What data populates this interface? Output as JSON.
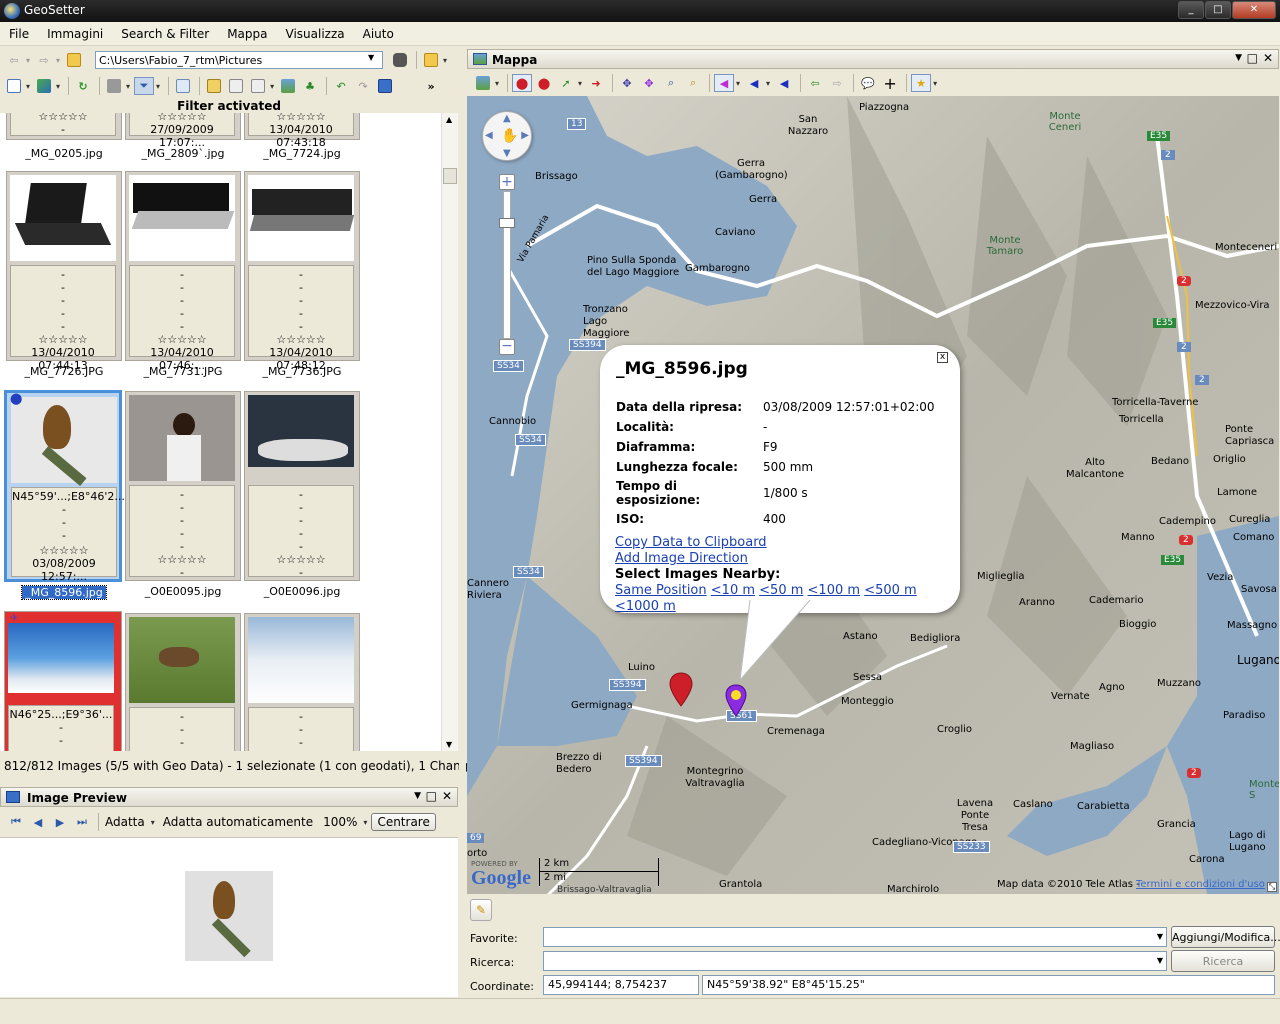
{
  "window": {
    "title": "GeoSetter",
    "buttons": [
      "_",
      "□",
      "✕"
    ]
  },
  "menu": [
    "File",
    "Immagini",
    "Search & Filter",
    "Mappa",
    "Visualizza",
    "Aiuto"
  ],
  "path": {
    "value": "C:\\Users\\Fabio_7_rtm\\Pictures"
  },
  "filter_label": "Filter activated",
  "thumbnails": {
    "row0": [
      {
        "date": "-",
        "name": "_MG_0205.jpg"
      },
      {
        "date": "27/09/2009 17:07:...",
        "name": "_MG_2809`.jpg"
      },
      {
        "date": "13/04/2010 07:43:18",
        "name": "_MG_7724.jpg"
      }
    ],
    "row1": [
      {
        "date": "13/04/2010 07:44:13",
        "name": "_MG_7726.JPG"
      },
      {
        "date": "13/04/2010 07:46:...",
        "name": "_MG_7731.JPG"
      },
      {
        "date": "13/04/2010 07:48:12",
        "name": "_MG_7736.JPG"
      }
    ],
    "row2": [
      {
        "coords": "N45°59'...;E8°46'2...",
        "date": "03/08/2009 12:57:...",
        "name": "_MG_8596.jpg"
      },
      {
        "coords": "-",
        "date": "-",
        "name": "_O0E0095.jpg"
      },
      {
        "coords": "-",
        "date": "-",
        "name": "_O0E0096.jpg"
      }
    ],
    "row3": [
      {
        "coords": "N46°25...;E9°36'..."
      },
      {
        "coords": "-"
      },
      {
        "coords": "-"
      }
    ],
    "dash": "-",
    "stars": "☆☆☆☆☆"
  },
  "status": "812/812 Images (5/5 with Geo Data) - 1 selezionate (1 con geodati), 1 Changed",
  "preview": {
    "title": "Image Preview",
    "fit": "Adatta",
    "autofit": "Adatta automaticamente",
    "zoom": "100%",
    "center": "Centrare"
  },
  "map_panel": {
    "title": "Mappa"
  },
  "popup": {
    "title": "_MG_8596.jpg",
    "close": "x",
    "rows": [
      {
        "k": "Data della ripresa:",
        "v": "03/08/2009 12:57:01+02:00"
      },
      {
        "k": "Località:",
        "v": "-"
      },
      {
        "k": "Diaframma:",
        "v": "F9"
      },
      {
        "k": "Lunghezza focale:",
        "v": "500 mm"
      },
      {
        "k": "Tempo di esposizione:",
        "v": "1/800 s"
      },
      {
        "k": "ISO:",
        "v": "400"
      }
    ],
    "copy": "Copy Data to Clipboard",
    "direction": "Add Image Direction",
    "nearby": "Select Images Nearby:",
    "same": "Same Position",
    "r10": "<10 m",
    "r50": "<50 m",
    "r100": "<100 m",
    "r500": "<500 m",
    "r1000": "<1000 m"
  },
  "map_labels": {
    "piazzogna": "Piazzogna",
    "san_nazzaro": "San Nazzaro",
    "monte_ceneri": "Monte Ceneri",
    "gerra_gamb": "Gerra (Gambarogno)",
    "gerra": "Gerra",
    "brissago": "Brissago",
    "caviano": "Caviano",
    "pino": "Pino Sulla Sponda del Lago Maggiore",
    "gambarogno": "Gambarogno",
    "monte_tamaro": "Monte Tamaro",
    "monteceneri": "Monteceneri",
    "tronzano": "Tronzano Lago Maggiore",
    "mezzovico": "Mezzovico-Vira",
    "cannobio": "Cannobio",
    "torricella_t": "Torricella-Taverne",
    "torricella": "Torricella",
    "ponte_capriasca": "Ponte Capriasca",
    "bedano": "Bedano",
    "origlio": "Origlio",
    "alto_malcantone": "Alto Malcantone",
    "lamone": "Lamone",
    "cademario_top": "Cadempino",
    "cureglia": "Cureglia",
    "manno": "Manno",
    "comano": "Comano",
    "miglieglia": "Miglieglia",
    "vezia": "Vezia",
    "savosa": "Savosa",
    "cannero": "Cannero Riviera",
    "aranno": "Aranno",
    "cademario": "Cademario",
    "massagno": "Massagno",
    "bioggio": "Bioggio",
    "astano": "Astano",
    "bedigliora": "Bedigliora",
    "lugano": "Lugano",
    "luino": "Luino",
    "sessa": "Sessa",
    "agno": "Agno",
    "muzzano": "Muzzano",
    "germignaga": "Germignaga",
    "monteggio": "Monteggio",
    "vernate": "Vernate",
    "paradiso": "Paradiso",
    "cremenaga": "Cremenaga",
    "croglio": "Croglio",
    "magliaso": "Magliaso",
    "brezzo": "Brezzo di Bedero",
    "montegrino": "Montegrino Valtravaglia",
    "lavena": "Lavena Ponte Tresa",
    "caslano": "Caslano",
    "carabietta": "Carabietta",
    "grancia": "Grancia",
    "monte_s": "Monte S",
    "lago_lugano": "Lago di Lugano",
    "cadegliano": "Cadegliano-Viconago",
    "carona": "Carona",
    "grantola": "Grantola",
    "marchirolo": "Marchirolo",
    "porto": "orto",
    "via_pamaria": "Via Pamaria"
  },
  "roads": {
    "r13": "13",
    "e35a": "E35",
    "e35b": "E35",
    "e35c": "E35",
    "e35d": "E35",
    "r2a": "2",
    "r2b": "2",
    "r2c": "2",
    "r2d": "2",
    "r2e": "2",
    "r2f": "2",
    "ss394a": "SS394",
    "ss394b": "SS394",
    "ss394c": "SS394",
    "ss34a": "SS34",
    "ss34b": "SS34",
    "ss34c": "SS34",
    "ss61": "SS61",
    "ss233": "SS233",
    "r69": "69"
  },
  "map_footer": {
    "scale_km": "2 km",
    "scale_mi": "2 mi",
    "google": "Google",
    "powered": "POWERED BY",
    "attribution": "Map data ©2010 Tele Atlas -",
    "terms": "Termini e condizioni d'uso",
    "bissago": "Brissago-Valtravaglia"
  },
  "form": {
    "favorite_label": "Favorite:",
    "favorite_value": "",
    "add_button": "Aggiungi/Modifica...",
    "search_label": "Ricerca:",
    "search_value": "",
    "search_button": "Ricerca",
    "coord_label": "Coordinate:",
    "coord_decimal": "45,994144; 8,754237",
    "coord_dms": "N45°59'38.92\" E8°45'15.25\""
  },
  "colors": {
    "selection": "#316ac5",
    "link": "#1a3fb0",
    "water": "#8ea9c4",
    "marker_red": "#cc1f2a",
    "marker_purple": "#8a2be2"
  }
}
